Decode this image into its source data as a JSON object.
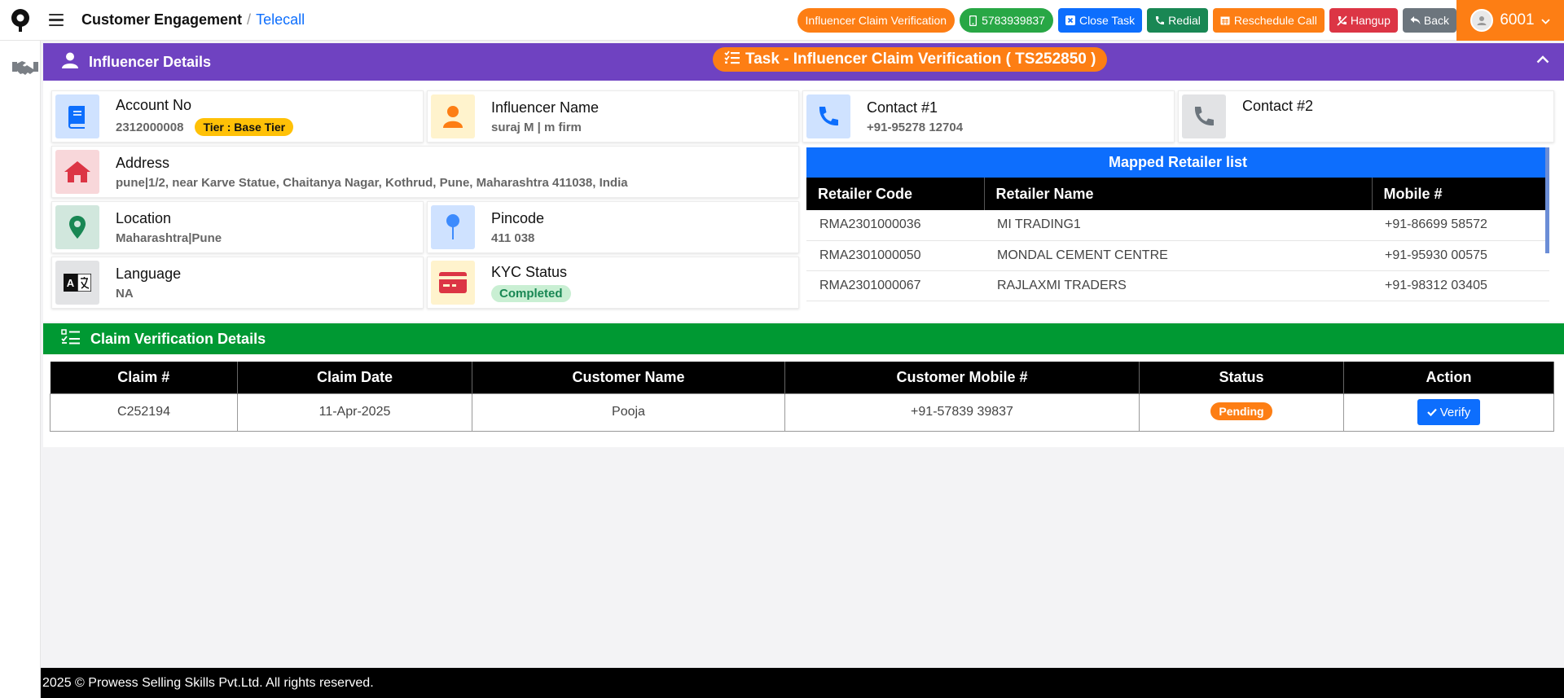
{
  "app": {
    "title": "Customer Engagement",
    "section": "Telecall"
  },
  "actions": {
    "claim_verification": "Influencer Claim Verification",
    "phone": "5783939837",
    "close_task": "Close Task",
    "redial": "Redial",
    "reschedule": "Reschedule Call",
    "hangup": "Hangup",
    "back": "Back"
  },
  "user": {
    "id": "6001"
  },
  "influencer": {
    "header": "Influencer Details",
    "task": "Task - Influencer Claim Verification ( TS252850 )",
    "account": {
      "label": "Account No",
      "value": "2312000008",
      "tier": "Tier : Base Tier"
    },
    "name": {
      "label": "Influencer Name",
      "value": "suraj M | m firm"
    },
    "contact1": {
      "label": "Contact #1",
      "value": "+91-95278 12704"
    },
    "contact2": {
      "label": "Contact #2",
      "value": ""
    },
    "address": {
      "label": "Address",
      "value": "pune|1/2, near Karve Statue, Chaitanya Nagar, Kothrud, Pune, Maharashtra 411038, India"
    },
    "location": {
      "label": "Location",
      "value": "Maharashtra|Pune"
    },
    "pincode": {
      "label": "Pincode",
      "value": "411 038"
    },
    "language": {
      "label": "Language",
      "value": "NA"
    },
    "kyc": {
      "label": "KYC Status",
      "value": "Completed"
    }
  },
  "mapped": {
    "title": "Mapped Retailer list",
    "columns": [
      "Retailer Code",
      "Retailer Name",
      "Mobile #"
    ],
    "rows": [
      [
        "RMA2301000036",
        "MI TRADING1",
        "+91-86699 58572"
      ],
      [
        "RMA2301000050",
        "MONDAL CEMENT CENTRE",
        "+91-95930 00575"
      ],
      [
        "RMA2301000067",
        "RAJLAXMI TRADERS",
        "+91-98312 03405"
      ]
    ]
  },
  "claim": {
    "header": "Claim Verification Details",
    "columns": [
      "Claim #",
      "Claim Date",
      "Customer Name",
      "Customer Mobile #",
      "Status",
      "Action"
    ],
    "row": {
      "claim_no": "C252194",
      "date": "11-Apr-2025",
      "customer": "Pooja",
      "mobile": "+91-57839 39837",
      "status": "Pending",
      "action": "Verify"
    }
  },
  "footer": "2025 © Prowess Selling Skills Pvt.Ltd. All rights reserved.",
  "colors": {
    "purple": "#6f42c1",
    "orange": "#fd7e14",
    "green": "#009933",
    "blue": "#0d6efd",
    "red": "#dc3545",
    "gray": "#6c757d"
  }
}
